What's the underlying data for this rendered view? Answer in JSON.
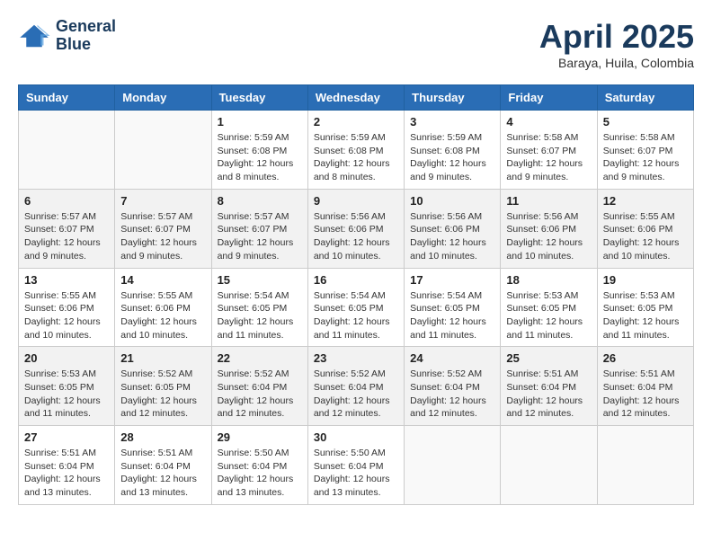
{
  "header": {
    "logo_line1": "General",
    "logo_line2": "Blue",
    "month": "April 2025",
    "location": "Baraya, Huila, Colombia"
  },
  "days_of_week": [
    "Sunday",
    "Monday",
    "Tuesday",
    "Wednesday",
    "Thursday",
    "Friday",
    "Saturday"
  ],
  "weeks": [
    [
      {
        "num": "",
        "info": ""
      },
      {
        "num": "",
        "info": ""
      },
      {
        "num": "1",
        "info": "Sunrise: 5:59 AM\nSunset: 6:08 PM\nDaylight: 12 hours\nand 8 minutes."
      },
      {
        "num": "2",
        "info": "Sunrise: 5:59 AM\nSunset: 6:08 PM\nDaylight: 12 hours\nand 8 minutes."
      },
      {
        "num": "3",
        "info": "Sunrise: 5:59 AM\nSunset: 6:08 PM\nDaylight: 12 hours\nand 9 minutes."
      },
      {
        "num": "4",
        "info": "Sunrise: 5:58 AM\nSunset: 6:07 PM\nDaylight: 12 hours\nand 9 minutes."
      },
      {
        "num": "5",
        "info": "Sunrise: 5:58 AM\nSunset: 6:07 PM\nDaylight: 12 hours\nand 9 minutes."
      }
    ],
    [
      {
        "num": "6",
        "info": "Sunrise: 5:57 AM\nSunset: 6:07 PM\nDaylight: 12 hours\nand 9 minutes."
      },
      {
        "num": "7",
        "info": "Sunrise: 5:57 AM\nSunset: 6:07 PM\nDaylight: 12 hours\nand 9 minutes."
      },
      {
        "num": "8",
        "info": "Sunrise: 5:57 AM\nSunset: 6:07 PM\nDaylight: 12 hours\nand 9 minutes."
      },
      {
        "num": "9",
        "info": "Sunrise: 5:56 AM\nSunset: 6:06 PM\nDaylight: 12 hours\nand 10 minutes."
      },
      {
        "num": "10",
        "info": "Sunrise: 5:56 AM\nSunset: 6:06 PM\nDaylight: 12 hours\nand 10 minutes."
      },
      {
        "num": "11",
        "info": "Sunrise: 5:56 AM\nSunset: 6:06 PM\nDaylight: 12 hours\nand 10 minutes."
      },
      {
        "num": "12",
        "info": "Sunrise: 5:55 AM\nSunset: 6:06 PM\nDaylight: 12 hours\nand 10 minutes."
      }
    ],
    [
      {
        "num": "13",
        "info": "Sunrise: 5:55 AM\nSunset: 6:06 PM\nDaylight: 12 hours\nand 10 minutes."
      },
      {
        "num": "14",
        "info": "Sunrise: 5:55 AM\nSunset: 6:06 PM\nDaylight: 12 hours\nand 10 minutes."
      },
      {
        "num": "15",
        "info": "Sunrise: 5:54 AM\nSunset: 6:05 PM\nDaylight: 12 hours\nand 11 minutes."
      },
      {
        "num": "16",
        "info": "Sunrise: 5:54 AM\nSunset: 6:05 PM\nDaylight: 12 hours\nand 11 minutes."
      },
      {
        "num": "17",
        "info": "Sunrise: 5:54 AM\nSunset: 6:05 PM\nDaylight: 12 hours\nand 11 minutes."
      },
      {
        "num": "18",
        "info": "Sunrise: 5:53 AM\nSunset: 6:05 PM\nDaylight: 12 hours\nand 11 minutes."
      },
      {
        "num": "19",
        "info": "Sunrise: 5:53 AM\nSunset: 6:05 PM\nDaylight: 12 hours\nand 11 minutes."
      }
    ],
    [
      {
        "num": "20",
        "info": "Sunrise: 5:53 AM\nSunset: 6:05 PM\nDaylight: 12 hours\nand 11 minutes."
      },
      {
        "num": "21",
        "info": "Sunrise: 5:52 AM\nSunset: 6:05 PM\nDaylight: 12 hours\nand 12 minutes."
      },
      {
        "num": "22",
        "info": "Sunrise: 5:52 AM\nSunset: 6:04 PM\nDaylight: 12 hours\nand 12 minutes."
      },
      {
        "num": "23",
        "info": "Sunrise: 5:52 AM\nSunset: 6:04 PM\nDaylight: 12 hours\nand 12 minutes."
      },
      {
        "num": "24",
        "info": "Sunrise: 5:52 AM\nSunset: 6:04 PM\nDaylight: 12 hours\nand 12 minutes."
      },
      {
        "num": "25",
        "info": "Sunrise: 5:51 AM\nSunset: 6:04 PM\nDaylight: 12 hours\nand 12 minutes."
      },
      {
        "num": "26",
        "info": "Sunrise: 5:51 AM\nSunset: 6:04 PM\nDaylight: 12 hours\nand 12 minutes."
      }
    ],
    [
      {
        "num": "27",
        "info": "Sunrise: 5:51 AM\nSunset: 6:04 PM\nDaylight: 12 hours\nand 13 minutes."
      },
      {
        "num": "28",
        "info": "Sunrise: 5:51 AM\nSunset: 6:04 PM\nDaylight: 12 hours\nand 13 minutes."
      },
      {
        "num": "29",
        "info": "Sunrise: 5:50 AM\nSunset: 6:04 PM\nDaylight: 12 hours\nand 13 minutes."
      },
      {
        "num": "30",
        "info": "Sunrise: 5:50 AM\nSunset: 6:04 PM\nDaylight: 12 hours\nand 13 minutes."
      },
      {
        "num": "",
        "info": ""
      },
      {
        "num": "",
        "info": ""
      },
      {
        "num": "",
        "info": ""
      }
    ]
  ]
}
